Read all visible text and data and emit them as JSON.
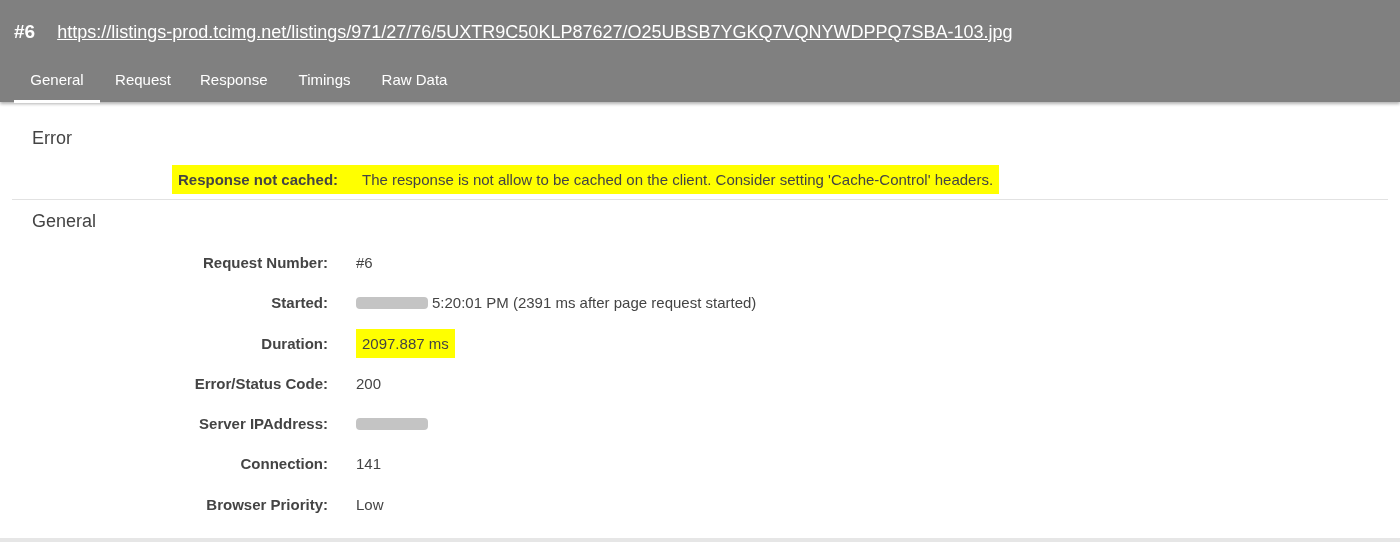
{
  "header": {
    "number": "#6",
    "url": "https://listings-prod.tcimg.net/listings/971/27/76/5UXTR9C50KLP87627/O25UBSB7YGKQ7VQNYWDPPQ7SBA-103.jpg"
  },
  "tabs": [
    {
      "label": "General",
      "selected": true
    },
    {
      "label": "Request",
      "selected": false
    },
    {
      "label": "Response",
      "selected": false
    },
    {
      "label": "Timings",
      "selected": false
    },
    {
      "label": "Raw Data",
      "selected": false
    }
  ],
  "sections": [
    {
      "title": "Error",
      "rows": [
        {
          "label": "Response not cached:",
          "value": "The response is not allow to be cached on the client. Consider setting 'Cache-Control' headers.",
          "highlighted": true,
          "redacted": false
        }
      ]
    },
    {
      "title": "General",
      "rows": [
        {
          "label": "Request Number:",
          "value": "#6",
          "highlighted": false,
          "redacted": false
        },
        {
          "label": "Started:",
          "value": "5:20:01 PM (2391 ms after page request started)",
          "highlighted": false,
          "redacted": true
        },
        {
          "label": "Duration:",
          "value": "2097.887 ms",
          "highlighted": true,
          "redacted": false
        },
        {
          "label": "Error/Status Code:",
          "value": "200",
          "highlighted": false,
          "redacted": false
        },
        {
          "label": "Server IPAddress:",
          "highlighted": false,
          "redacted": true
        },
        {
          "label": "Connection:",
          "value": "141",
          "highlighted": false,
          "redacted": false
        },
        {
          "label": "Browser Priority:",
          "value": "Low",
          "highlighted": false,
          "redacted": false
        }
      ]
    }
  ]
}
